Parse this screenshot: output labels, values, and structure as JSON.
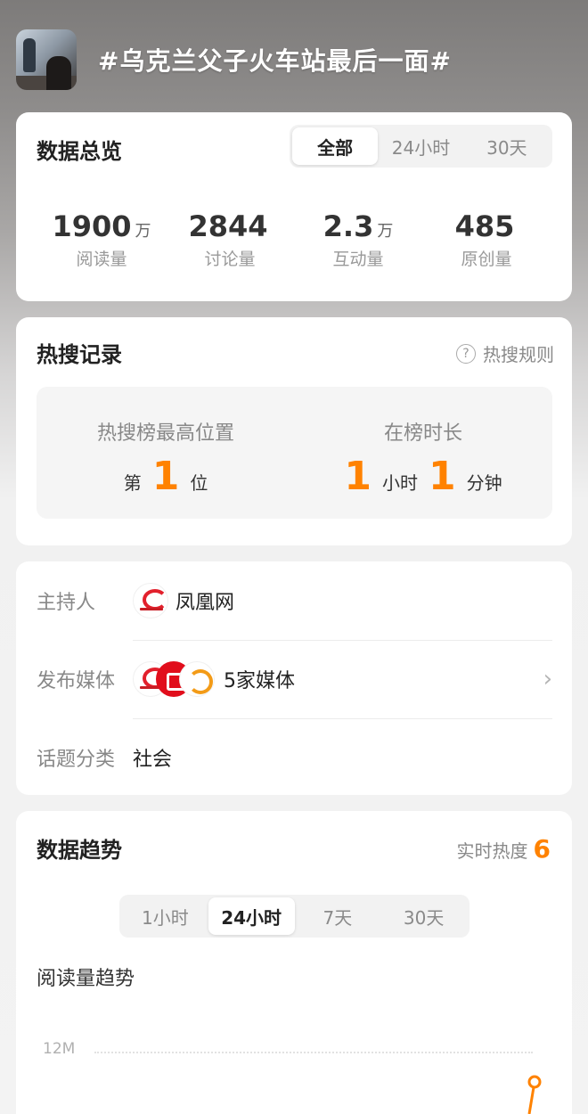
{
  "topic": {
    "title": "#乌克兰父子火车站最后一面#"
  },
  "overview": {
    "title": "数据总览",
    "tabs": [
      "全部",
      "24小时",
      "30天"
    ],
    "active_tab": 0,
    "stats": [
      {
        "value": "1900",
        "unit": "万",
        "label": "阅读量"
      },
      {
        "value": "2844",
        "unit": "",
        "label": "讨论量"
      },
      {
        "value": "2.3",
        "unit": "万",
        "label": "互动量"
      },
      {
        "value": "485",
        "unit": "",
        "label": "原创量"
      }
    ]
  },
  "hot_search": {
    "title": "热搜记录",
    "rules_label": "热搜规则",
    "highest_position": {
      "label": "热搜榜最高位置",
      "prefix": "第",
      "value": "1",
      "suffix": "位"
    },
    "duration": {
      "label": "在榜时长",
      "hours": "1",
      "hours_unit": "小时",
      "minutes": "1",
      "minutes_unit": "分钟"
    }
  },
  "info": {
    "host": {
      "label": "主持人",
      "value": "凤凰网"
    },
    "media": {
      "label": "发布媒体",
      "value": "5家媒体"
    },
    "category": {
      "label": "话题分类",
      "value": "社会"
    }
  },
  "trend": {
    "title": "数据趋势",
    "realtime_label": "实时热度",
    "realtime_value": "6",
    "tabs": [
      "1小时",
      "24小时",
      "7天",
      "30天"
    ],
    "active_tab": 1,
    "subtitle": "阅读量趋势",
    "tick_label": "12M",
    "accent": "#ff8200"
  },
  "colors": {
    "accent": "#ff8200",
    "card": "#ffffff"
  },
  "icons": {
    "help": "help-circle-icon",
    "chevron": "chevron-right-icon"
  }
}
